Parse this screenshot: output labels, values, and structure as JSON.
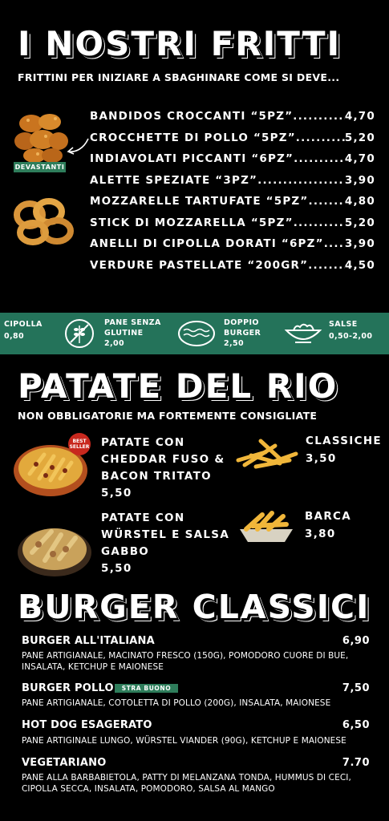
{
  "fritti": {
    "title": "I NOSTRI FRITTI",
    "subtitle": "FRITTINI PER INIZIARE A SBAGHINARE COME SI DEVE...",
    "badge": "DEVASTANTI",
    "items": [
      {
        "name": "BANDIDOS CROCCANTI “5PZ”",
        "price": "4,70"
      },
      {
        "name": "CROCCHETTE DI POLLO “5PZ”",
        "price": "5,20"
      },
      {
        "name": "INDIAVOLATI PICCANTI “6PZ”",
        "price": "4,70"
      },
      {
        "name": "ALETTE SPEZIATE “3PZ”",
        "price": "3,90"
      },
      {
        "name": "MOZZARELLE TARTUFATE “5PZ”",
        "price": "4,80"
      },
      {
        "name": "STICK DI MOZZARELLA “5PZ”",
        "price": "5,20"
      },
      {
        "name": "ANELLI DI CIPOLLA DORATI “6PZ”",
        "price": "3,90"
      },
      {
        "name": "VERDURE PASTELLATE “200GR”",
        "price": "4,50"
      }
    ]
  },
  "extras": {
    "cipolla": {
      "label": "CIPOLLA",
      "price": "0,80"
    },
    "pane": {
      "label1": "PANE SENZA",
      "label2": "GLUTINE",
      "price": "2,00",
      "icon": "gluten-free-icon"
    },
    "doppio": {
      "label1": "DOPPIO",
      "label2": "BURGER",
      "price": "2,50",
      "icon": "burger-patty-icon"
    },
    "salse": {
      "label": "SALSE",
      "price": "0,50-2,00",
      "icon": "sauce-bowl-icon"
    }
  },
  "patate": {
    "title": "PATATE DEL RIO",
    "subtitle": "NON OBBLIGATORIE MA FORTEMENTE CONSIGLIATE",
    "best_seller": {
      "line1": "BEST",
      "line2": "SELLER"
    },
    "cheddar": {
      "l1": "PATATE CON",
      "l2": "CHEDDAR FUSO &",
      "l3": "BACON TRITATO",
      "price": "5,50"
    },
    "classiche": {
      "name": "CLASSICHE",
      "price": "3,50"
    },
    "wurstel": {
      "l1": "PATATE CON",
      "l2": "WÜRSTEL E SALSA",
      "l3": "GABBO",
      "price": "5,50"
    },
    "barca": {
      "name": "BARCA",
      "price": "3,80"
    }
  },
  "burger": {
    "title": "BURGER CLASSICI",
    "tag": "STRA BUONO",
    "items": [
      {
        "name": "BURGER ALL'ITALIANA",
        "price": "6,90",
        "desc": "PANE ARTIGIANALE, MACINATO FRESCO (150G), POMODORO CUORE DI BUE, INSALATA, KETCHUP E MAIONESE"
      },
      {
        "name": "BURGER POLLO",
        "price": "7,50",
        "desc": "PANE ARTIGIANALE, COTOLETTA DI POLLO (200G), INSALATA, MAIONESE"
      },
      {
        "name": "HOT DOG ESAGERATO",
        "price": "6,50",
        "desc": "PANE ARTIGINALE LUNGO, WÜRSTEL VIANDER (90G), KETCHUP E MAIONESE"
      },
      {
        "name": "VEGETARIANO",
        "price": "7.70",
        "desc": "PANE ALLA BARBABIETOLA, PATTY DI MELANZANA TONDA, HUMMUS DI CECI, CIPOLLA SECCA, INSALATA, POMODORO, SALSA AL MANGO"
      }
    ]
  },
  "colors": {
    "background": "#000000",
    "accent_green": "#24735a",
    "text": "#ffffff",
    "best_seller_red": "#c8281e"
  }
}
